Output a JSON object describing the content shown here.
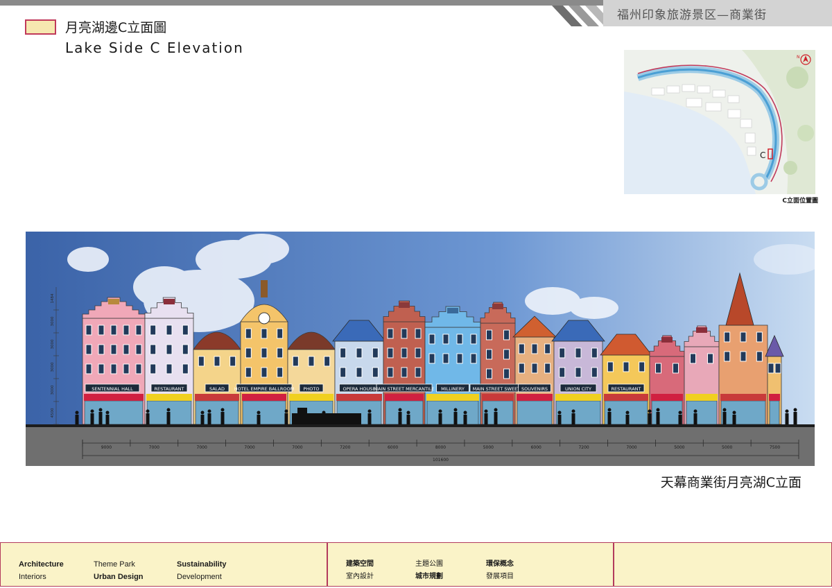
{
  "header": {
    "title": "福州印象旅游景区—商業街"
  },
  "page": {
    "title_zh": "月亮湖邊C立面圖",
    "title_en": "Lake Side C Elevation",
    "swatch_color": "#f6e8b0",
    "accent_color": "#c0395a"
  },
  "location_map": {
    "north_label": "N",
    "marker_label": "C",
    "caption": "C立面位置圖"
  },
  "elevation": {
    "caption": "天幕商業街月亮湖C立面",
    "signs": [
      "SENTENNIAL HALL",
      "RESTAURANT",
      "SALAD",
      "HOTEL EMPIRE BALLROOM",
      "PHOTO",
      "OPERA HOUSE",
      "MAIN STREET MERCANTILE",
      "MILLINERY",
      "MAIN STREET SWEETS",
      "SOUVENIRS",
      "UNION CITY",
      "RESTAURANT"
    ],
    "dimensions": [
      "9000",
      "7000",
      "7000",
      "7000",
      "7000",
      "7200",
      "6000",
      "8000",
      "5000",
      "6000",
      "7200",
      "7000",
      "5000",
      "5000",
      "7500"
    ],
    "total_dimension": "101600",
    "height_dims": [
      "4500",
      "3000",
      "3000",
      "3000",
      "3000",
      "1484"
    ]
  },
  "footer": {
    "col1": [
      "Architecture",
      "Interiors"
    ],
    "col2": [
      "Theme Park",
      "Urban Design"
    ],
    "col3": [
      "Sustainability",
      "Development"
    ],
    "col4": [
      "建築空間",
      "室內設計"
    ],
    "col5": [
      "主題公園",
      "城市規劃"
    ],
    "col6": [
      "環保概念",
      "發展項目"
    ]
  }
}
